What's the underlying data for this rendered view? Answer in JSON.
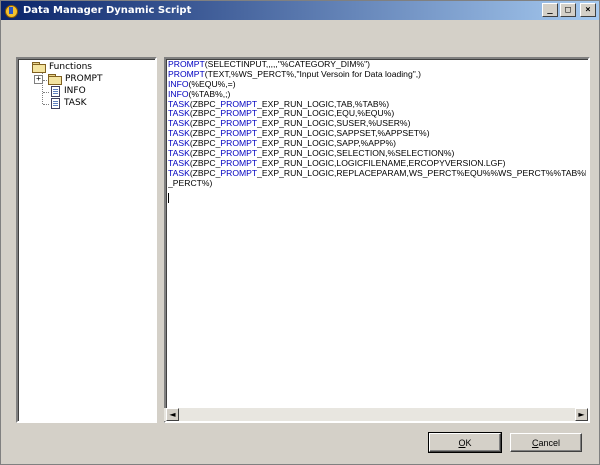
{
  "window": {
    "title": "Data Manager Dynamic Script",
    "controls": {
      "minimize": "_",
      "maximize": "□",
      "close": "×"
    }
  },
  "tree": {
    "root": {
      "label": "Functions",
      "icon": "folder-icon",
      "expander": ""
    },
    "children": [
      {
        "label": "PROMPT",
        "icon": "folder-icon",
        "expander": "+"
      },
      {
        "label": "INFO",
        "icon": "document-icon"
      },
      {
        "label": "TASK",
        "icon": "document-icon"
      }
    ]
  },
  "script": {
    "lines": [
      {
        "kw": "PROMPT",
        "kw2": "",
        "pre": "",
        "mid": "",
        "rest": "(SELECTINPUT,,,,,\"%CATEGORY_DIM%\")"
      },
      {
        "kw": "PROMPT",
        "kw2": "",
        "pre": "",
        "mid": "",
        "rest": "(TEXT,%WS_PERCT%,\"Input Versoin for Data loading\",)"
      },
      {
        "kw": "INFO",
        "kw2": "",
        "pre": "",
        "mid": "",
        "rest": "(%EQU%,=)"
      },
      {
        "kw": "INFO",
        "kw2": "",
        "pre": "",
        "mid": "",
        "rest": "(%TAB%,;)"
      },
      {
        "kw": "TASK",
        "kw2": "PROMPT",
        "pre": "(ZBPC_",
        "mid": "",
        "rest": "_EXP_RUN_LOGIC,TAB,%TAB%)"
      },
      {
        "kw": "TASK",
        "kw2": "PROMPT",
        "pre": "(ZBPC_",
        "mid": "",
        "rest": "_EXP_RUN_LOGIC,EQU,%EQU%)"
      },
      {
        "kw": "TASK",
        "kw2": "PROMPT",
        "pre": "(ZBPC_",
        "mid": "",
        "rest": "_EXP_RUN_LOGIC,SUSER,%USER%)"
      },
      {
        "kw": "TASK",
        "kw2": "PROMPT",
        "pre": "(ZBPC_",
        "mid": "",
        "rest": "_EXP_RUN_LOGIC,SAPPSET,%APPSET%)"
      },
      {
        "kw": "TASK",
        "kw2": "PROMPT",
        "pre": "(ZBPC_",
        "mid": "",
        "rest": "_EXP_RUN_LOGIC,SAPP,%APP%)"
      },
      {
        "kw": "TASK",
        "kw2": "PROMPT",
        "pre": "(ZBPC_",
        "mid": "",
        "rest": "_EXP_RUN_LOGIC,SELECTION,%SELECTION%)"
      },
      {
        "kw": "TASK",
        "kw2": "PROMPT",
        "pre": "(ZBPC_",
        "mid": "",
        "rest": "_EXP_RUN_LOGIC,LOGICFILENAME,ERCOPYVERSION.LGF)"
      },
      {
        "kw": "TASK",
        "kw2": "PROMPT",
        "pre": "(ZBPC_",
        "mid": "",
        "rest": "_EXP_RUN_LOGIC,REPLACEPARAM,WS_PERCT%EQU%%WS_PERCT%%TAB%EXF"
      },
      {
        "kw": "",
        "kw2": "",
        "pre": "",
        "mid": "",
        "rest": "_PERCT%)"
      }
    ]
  },
  "scrollbar": {
    "left_arrow": "◄",
    "right_arrow": "►"
  },
  "buttons": {
    "ok": {
      "accel": "O",
      "rest": "K"
    },
    "cancel": {
      "accel": "C",
      "rest": "ancel"
    }
  }
}
